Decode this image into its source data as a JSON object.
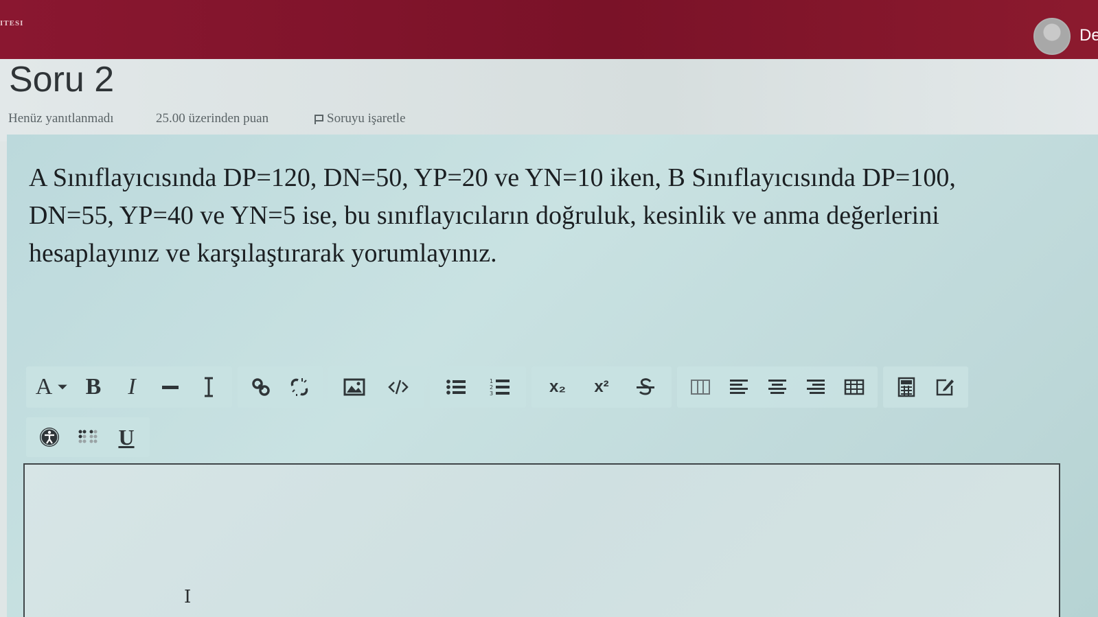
{
  "topbar": {
    "brand": "ITESI",
    "user_name": "De"
  },
  "question": {
    "title": "Soru 2",
    "state": "Henüz yanıtlanmadı",
    "grade": "25.00 üzerinden puan",
    "flag_label": "Soruyu işaretle",
    "text_lines": [
      "A Sınıflayıcısında DP=120, DN=50, YP=20 ve YN=10 iken, B Sınıflayıcısında DP=100,",
      "DN=55, YP=40 ve YN=5 ise, bu sınıflayıcıların doğruluk, kesinlik ve anma değerlerini",
      "hesaplayınız ve karşılaştırarak yorumlayınız."
    ]
  },
  "toolbar": {
    "font_label": "A",
    "bold_label": "B",
    "italic_label": "I",
    "subscript": "x₂",
    "superscript": "x²",
    "underline_label": "U"
  },
  "editor": {
    "value": ""
  },
  "colors": {
    "banner": "#7a1228",
    "panel": "#c2dcdd",
    "text": "#1b1f22"
  }
}
